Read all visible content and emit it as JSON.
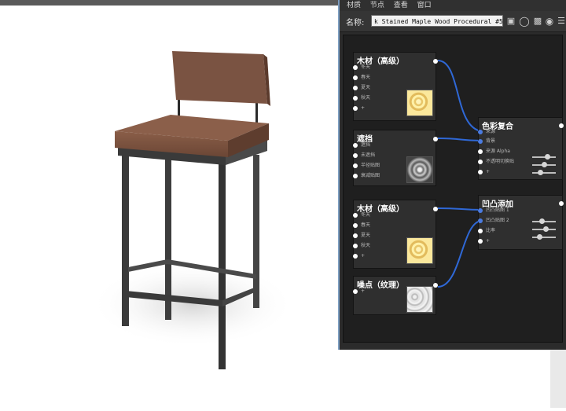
{
  "menubar": {
    "items": [
      "材质",
      "节点",
      "查看",
      "窗口"
    ]
  },
  "namebar": {
    "label": "名称:",
    "value": "k Stained Maple Wood Procedural #5"
  },
  "nodes": {
    "wood1": {
      "title": "木材（高级）",
      "inputs": [
        "冬天",
        "春天",
        "夏天",
        "秋天",
        "+"
      ]
    },
    "mask": {
      "title": "遮挡",
      "inputs": [
        "遮挡",
        "未遮挡",
        "半径贴图",
        "衰减贴图"
      ]
    },
    "color": {
      "title": "色彩复合",
      "inputs": [
        "来源",
        "背景",
        "来源 Alpha",
        "不透明切换贴",
        "+"
      ]
    },
    "wood2": {
      "title": "木材（高级）",
      "inputs": [
        "冬天",
        "春天",
        "夏天",
        "秋天",
        "+"
      ]
    },
    "bump": {
      "title": "凹凸添加",
      "inputs": [
        "凹凸贴图 1",
        "凹凸贴图 2",
        "比率",
        "+"
      ]
    },
    "noise": {
      "title": "噪点（纹理）",
      "inputs": [
        "+"
      ]
    }
  },
  "sliders": {
    "color": [
      0.7,
      0.5,
      0.3
    ],
    "bump": [
      0.4,
      0.6,
      0.25
    ]
  },
  "colors": {
    "wire": "#2f68d6",
    "accent_border": "#7d9ec2",
    "node_bg": "#2f2f2f",
    "canvas_bg": "#1f1f1f"
  },
  "icons": [
    "save-icon",
    "sphere-preview-icon",
    "checker-icon",
    "render-icon",
    "settings-sliders-icon"
  ]
}
